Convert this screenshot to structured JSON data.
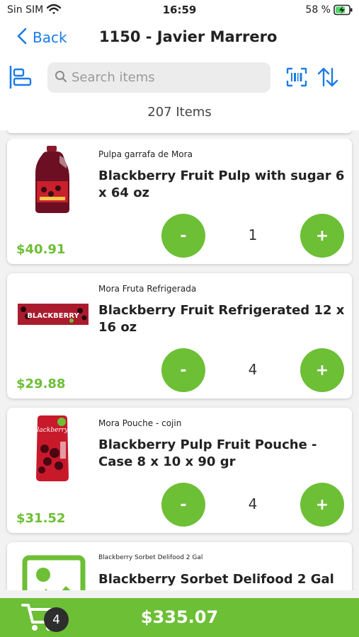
{
  "status_bar": {
    "carrier": "Sin SIM",
    "time": "16:59",
    "battery": "58 %"
  },
  "nav": {
    "back_label": "Back",
    "title": "1150 - Javier Marrero"
  },
  "search": {
    "placeholder": "Search items",
    "value": ""
  },
  "item_count": "207 Items",
  "items": [
    {
      "subtitle": "Pulpa garrafa de Mora",
      "name": "Blackberry Fruit Pulp with sugar 6 x 64 oz",
      "price": "$40.91",
      "qty": "1",
      "minus": "-",
      "plus": "+",
      "image": "jug-icon"
    },
    {
      "subtitle": "Mora Fruta Refrigerada",
      "name": "Blackberry Fruit Refrigerated  12 x 16 oz",
      "price": "$29.88",
      "qty": "4",
      "minus": "-",
      "plus": "+",
      "image": "box-icon",
      "image_text": "BLACKBERRY"
    },
    {
      "subtitle": "Mora Pouche - cojin",
      "name": "Blackberry Pulp Fruit Pouche - Case 8 x 10 x 90 gr",
      "price": "$31.52",
      "qty": "4",
      "minus": "-",
      "plus": "+",
      "image": "pouch-icon",
      "image_text": "Blackberry"
    },
    {
      "subtitle": "Blackberry Sorbet Delifood 2 Gal",
      "name": "Blackberry Sorbet Delifood 2 Gal",
      "image": "image-placeholder-icon"
    }
  ],
  "footer": {
    "cart_count": "4",
    "total": "$335.07"
  },
  "colors": {
    "accent_green": "#6dbf36",
    "link_blue": "#1a7ce6"
  }
}
